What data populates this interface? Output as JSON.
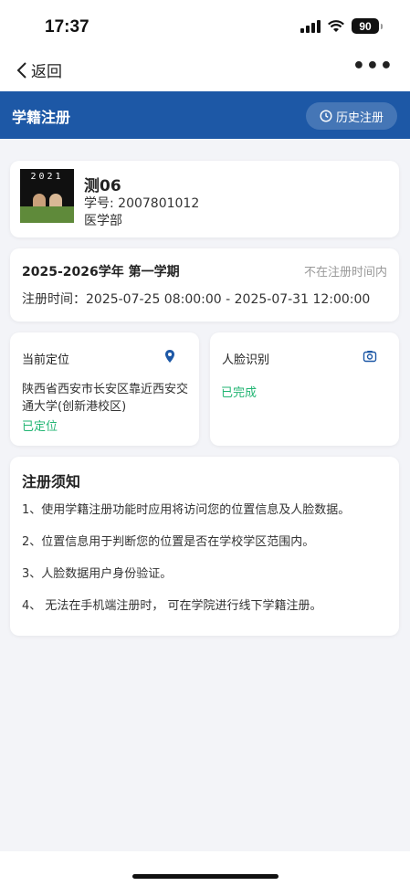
{
  "status_bar": {
    "time": "17:37",
    "battery": "90"
  },
  "nav": {
    "back_label": "返回",
    "more_label": "•••"
  },
  "header": {
    "title": "学籍注册",
    "history_label": "历史注册"
  },
  "profile": {
    "avatar_text": "2021",
    "name": "测06",
    "student_id": "学号: 2007801012",
    "department": "医学部"
  },
  "term": {
    "name": "2025-2026学年 第一学期",
    "status": "不在注册时间内",
    "time": "注册时间：2025-07-25 08:00:00 - 2025-07-31 12:00:00"
  },
  "location": {
    "title": "当前定位",
    "address": "陕西省西安市长安区靠近西安交通大学(创新港校区)",
    "status": "已定位"
  },
  "face": {
    "title": "人脸识别",
    "status": "已完成"
  },
  "notice": {
    "title": "注册须知",
    "items": [
      "1、使用学籍注册功能时应用将访问您的位置信息及人脸数据。",
      "2、位置信息用于判断您的位置是否在学校学区范围内。",
      "3、人脸数据用户身份验证。",
      "4、 无法在手机端注册时， 可在学院进行线下学籍注册。"
    ]
  },
  "colors": {
    "brand": "#1d58a6",
    "success": "#22b573",
    "muted": "#999999"
  }
}
